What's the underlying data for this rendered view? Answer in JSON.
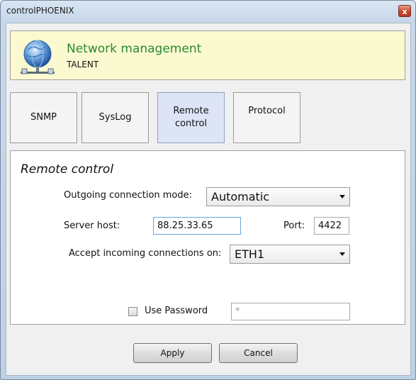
{
  "window": {
    "title": "controlPHOENIX",
    "close_glyph": "x"
  },
  "header": {
    "icon": "globe-network-icon",
    "title": "Network management",
    "subtitle": "TALENT"
  },
  "tabs": [
    {
      "label": "SNMP"
    },
    {
      "label": "SysLog"
    },
    {
      "label_line1": "Remote",
      "label_line2": "control",
      "active": true
    },
    {
      "label": "Protocol"
    }
  ],
  "panel": {
    "title": "Remote control",
    "outgoing_label": "Outgoing connection mode:",
    "outgoing_value": "Automatic",
    "server_host_label": "Server host:",
    "server_host_value": "88.25.33.65",
    "port_label": "Port:",
    "port_value": "4422",
    "accept_label": "Accept incoming connections on:",
    "accept_value": "ETH1",
    "use_password_label": "Use Password",
    "use_password_checked": false,
    "password_value": "*"
  },
  "buttons": {
    "apply": "Apply",
    "cancel": "Cancel"
  },
  "colors": {
    "header_bg": "#fbf9cf",
    "header_title": "#2a8a32",
    "active_tab": "#dde4f6"
  }
}
